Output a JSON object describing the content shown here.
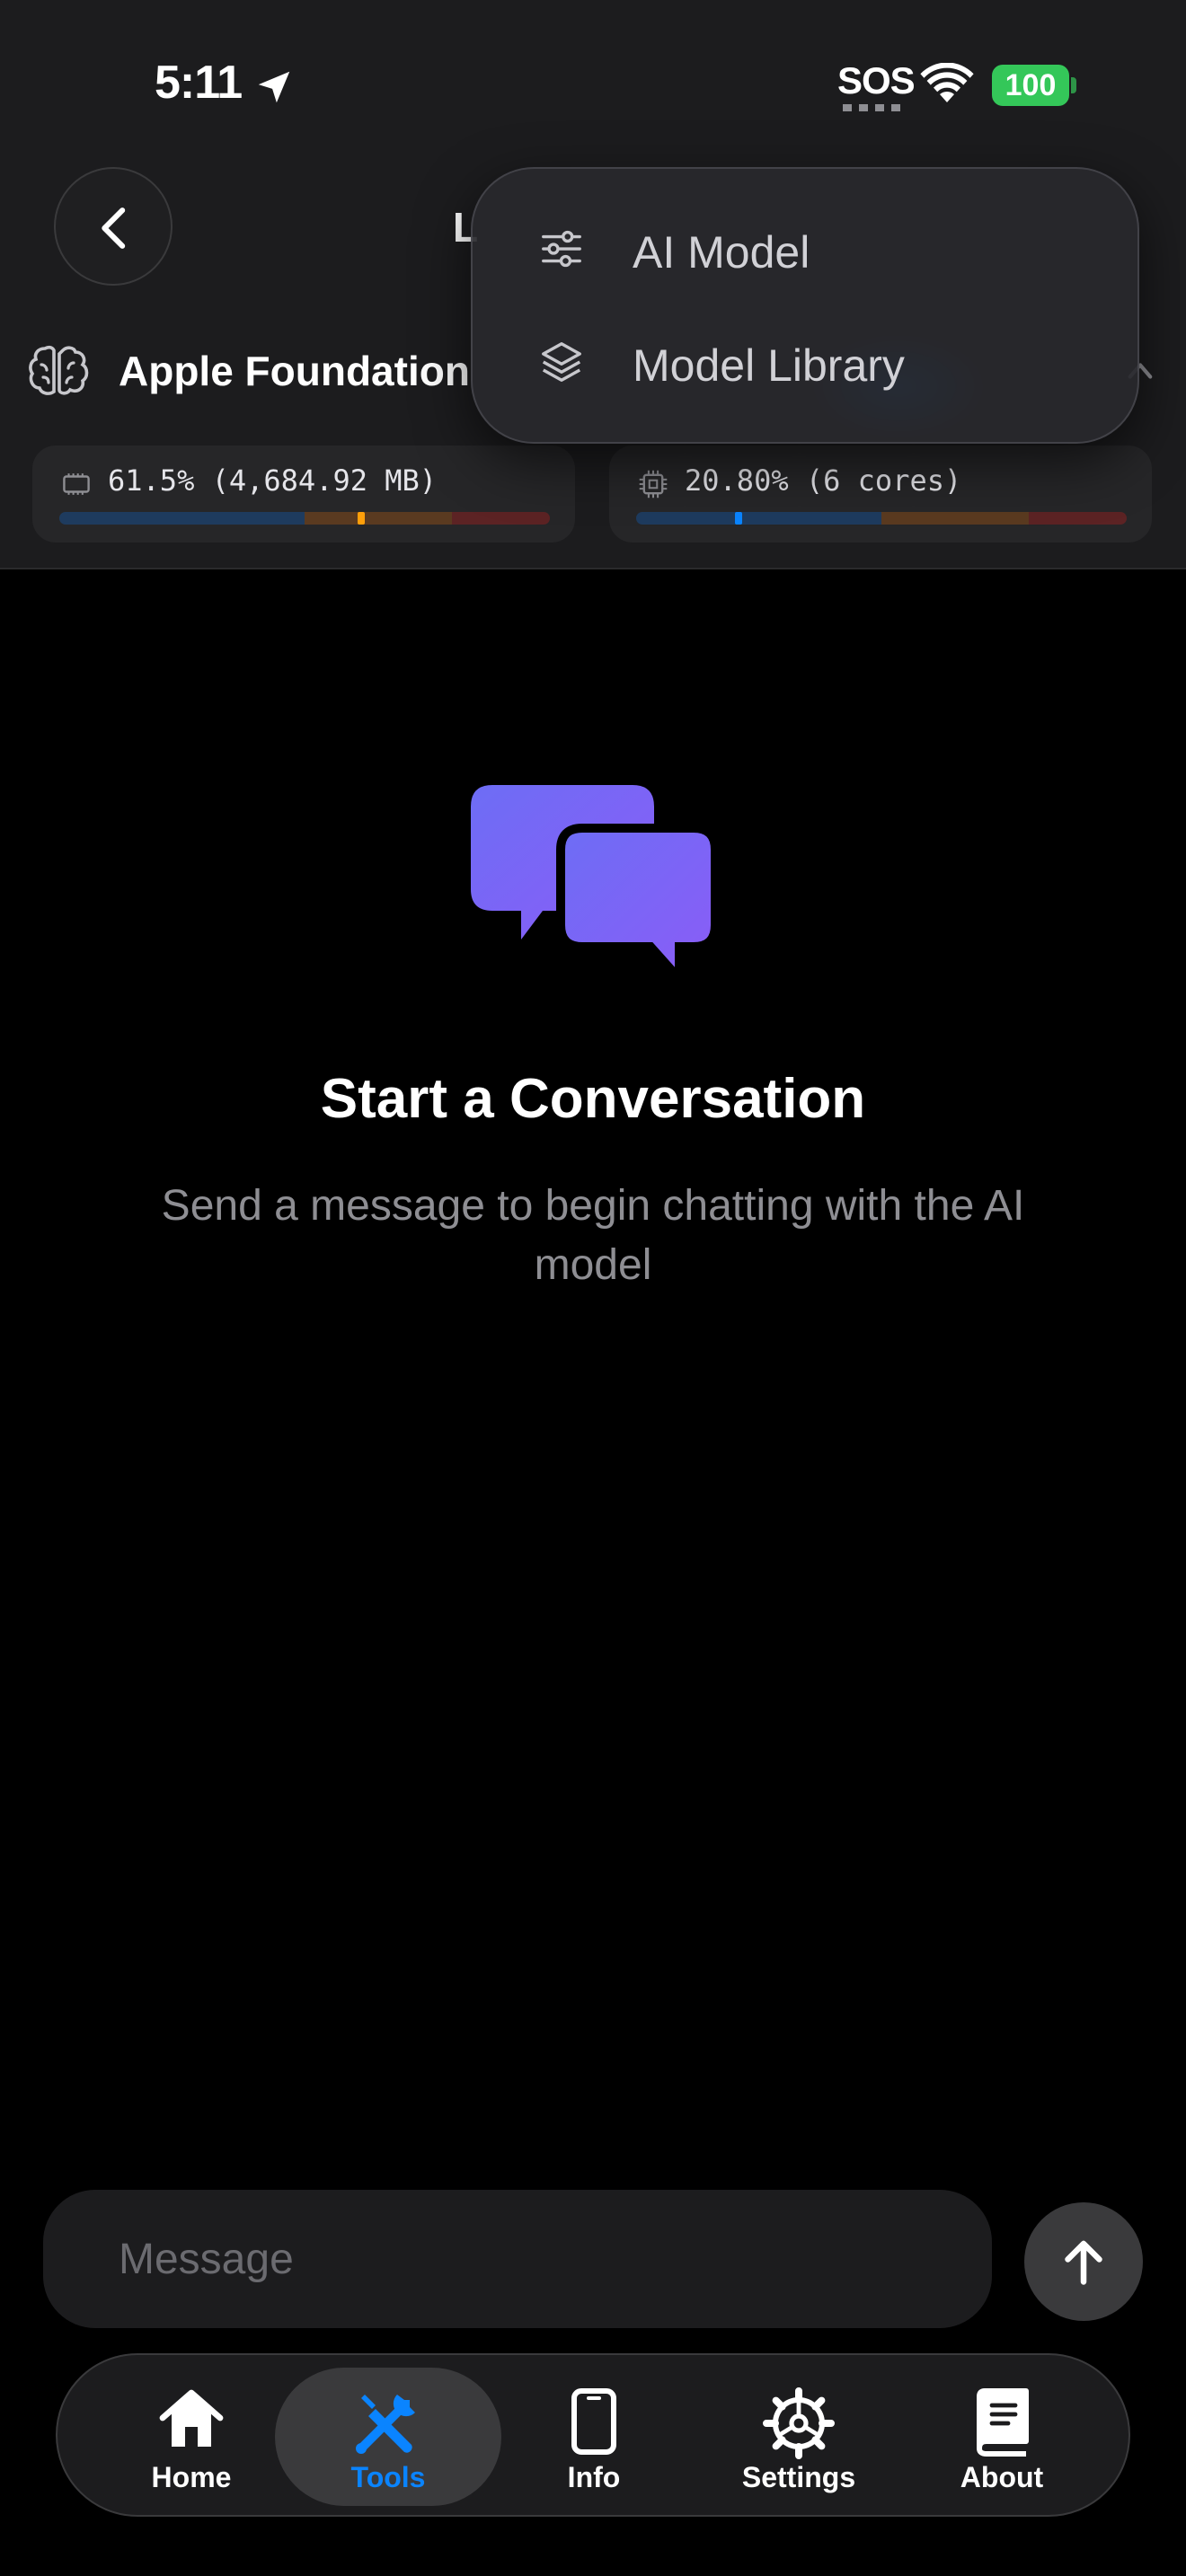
{
  "status_bar": {
    "time": "5:11",
    "sos": "SOS",
    "battery": "100",
    "location_icon": "location-arrow-icon",
    "wifi_icon": "wifi-icon"
  },
  "nav": {
    "title_partial": "L",
    "back_icon": "chevron-left-icon"
  },
  "model": {
    "name": "Apple Foundation",
    "icon": "brain-icon"
  },
  "monitors": {
    "memory": {
      "text": "61.5% (4,684.92 MB)",
      "level": 0.615,
      "marker_color": "#ff9f0a",
      "icon": "memory-chip-icon"
    },
    "cpu": {
      "text": "20.80% (6 cores)",
      "level": 0.208,
      "marker_color": "#0a84ff",
      "icon": "cpu-icon"
    }
  },
  "menu": {
    "items": [
      {
        "label": "AI Model",
        "icon": "sliders-icon"
      },
      {
        "label": "Model Library",
        "icon": "stack-layers-icon"
      }
    ]
  },
  "empty_state": {
    "title": "Start a Conversation",
    "subtitle": "Send a message to begin chatting with the AI model",
    "icon": "chat-bubbles-icon",
    "icon_color_start": "#6d6df5",
    "icon_color_end": "#8b5cf6"
  },
  "composer": {
    "placeholder": "Message",
    "value": "",
    "send_icon": "arrow-up-icon"
  },
  "tabbar": {
    "tabs": [
      {
        "label": "Home",
        "icon": "house-icon",
        "active": false
      },
      {
        "label": "Tools",
        "icon": "tools-icon",
        "active": true
      },
      {
        "label": "Info",
        "icon": "phone-icon",
        "active": false
      },
      {
        "label": "Settings",
        "icon": "gear-icon",
        "active": false
      },
      {
        "label": "About",
        "icon": "book-icon",
        "active": false
      }
    ],
    "active_color": "#0a84ff"
  }
}
